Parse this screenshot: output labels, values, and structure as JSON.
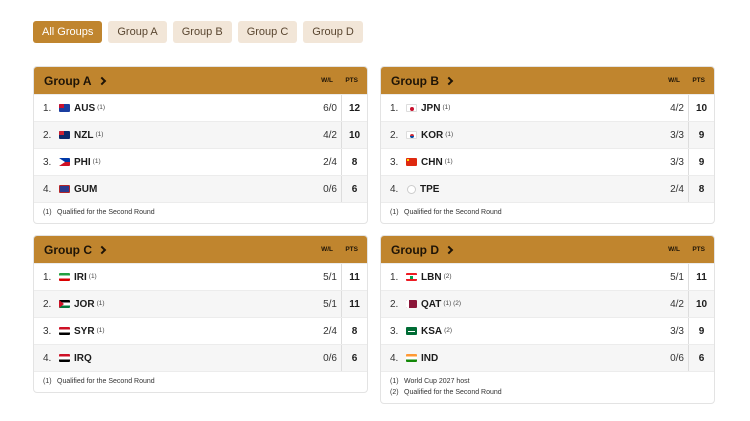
{
  "filters": [
    "All Groups",
    "Group A",
    "Group B",
    "Group C",
    "Group D"
  ],
  "active_filter": "All Groups",
  "columns": {
    "wl": "W/L",
    "pts": "PTS"
  },
  "colors": {
    "accent": "#c0852e",
    "filter_bg": "#f2e6d8",
    "row_alt": "#f6f6f6"
  },
  "groups": {
    "a": {
      "title": "Group A",
      "rows": [
        {
          "rank": "1.",
          "team": "AUS",
          "flag": "australia-flag",
          "sup": "(1)",
          "wl": "6/0",
          "pts": "12"
        },
        {
          "rank": "2.",
          "team": "NZL",
          "flag": "new-zealand-flag",
          "sup": "(1)",
          "wl": "4/2",
          "pts": "10"
        },
        {
          "rank": "3.",
          "team": "PHI",
          "flag": "philippines-flag",
          "sup": "(1)",
          "wl": "2/4",
          "pts": "8"
        },
        {
          "rank": "4.",
          "team": "GUM",
          "flag": "guam-flag",
          "sup": "",
          "wl": "0/6",
          "pts": "6"
        }
      ],
      "footnotes": [
        {
          "mark": "(1)",
          "text": "Qualified for the Second Round"
        }
      ]
    },
    "b": {
      "title": "Group B",
      "rows": [
        {
          "rank": "1.",
          "team": "JPN",
          "flag": "japan-flag",
          "sup": "(1)",
          "wl": "4/2",
          "pts": "10"
        },
        {
          "rank": "2.",
          "team": "KOR",
          "flag": "korea-flag",
          "sup": "(1)",
          "wl": "3/3",
          "pts": "9"
        },
        {
          "rank": "3.",
          "team": "CHN",
          "flag": "china-flag",
          "sup": "(1)",
          "wl": "3/3",
          "pts": "9"
        },
        {
          "rank": "4.",
          "team": "TPE",
          "flag": "chinese-taipei-flag",
          "sup": "",
          "wl": "2/4",
          "pts": "8"
        }
      ],
      "footnotes": [
        {
          "mark": "(1)",
          "text": "Qualified for the Second Round"
        }
      ]
    },
    "c": {
      "title": "Group C",
      "rows": [
        {
          "rank": "1.",
          "team": "IRI",
          "flag": "iran-flag",
          "sup": "(1)",
          "wl": "5/1",
          "pts": "11"
        },
        {
          "rank": "2.",
          "team": "JOR",
          "flag": "jordan-flag",
          "sup": "(1)",
          "wl": "5/1",
          "pts": "11"
        },
        {
          "rank": "3.",
          "team": "SYR",
          "flag": "syria-flag",
          "sup": "(1)",
          "wl": "2/4",
          "pts": "8"
        },
        {
          "rank": "4.",
          "team": "IRQ",
          "flag": "iraq-flag",
          "sup": "",
          "wl": "0/6",
          "pts": "6"
        }
      ],
      "footnotes": [
        {
          "mark": "(1)",
          "text": "Qualified for the Second Round"
        }
      ]
    },
    "d": {
      "title": "Group D",
      "rows": [
        {
          "rank": "1.",
          "team": "LBN",
          "flag": "lebanon-flag",
          "sup": "(2)",
          "wl": "5/1",
          "pts": "11"
        },
        {
          "rank": "2.",
          "team": "QAT",
          "flag": "qatar-flag",
          "sup": "(1) (2)",
          "wl": "4/2",
          "pts": "10"
        },
        {
          "rank": "3.",
          "team": "KSA",
          "flag": "saudi-arabia-flag",
          "sup": "(2)",
          "wl": "3/3",
          "pts": "9"
        },
        {
          "rank": "4.",
          "team": "IND",
          "flag": "india-flag",
          "sup": "",
          "wl": "0/6",
          "pts": "6"
        }
      ],
      "footnotes": [
        {
          "mark": "(1)",
          "text": "World Cup 2027 host"
        },
        {
          "mark": "(2)",
          "text": "Qualified for the Second Round"
        }
      ]
    }
  }
}
